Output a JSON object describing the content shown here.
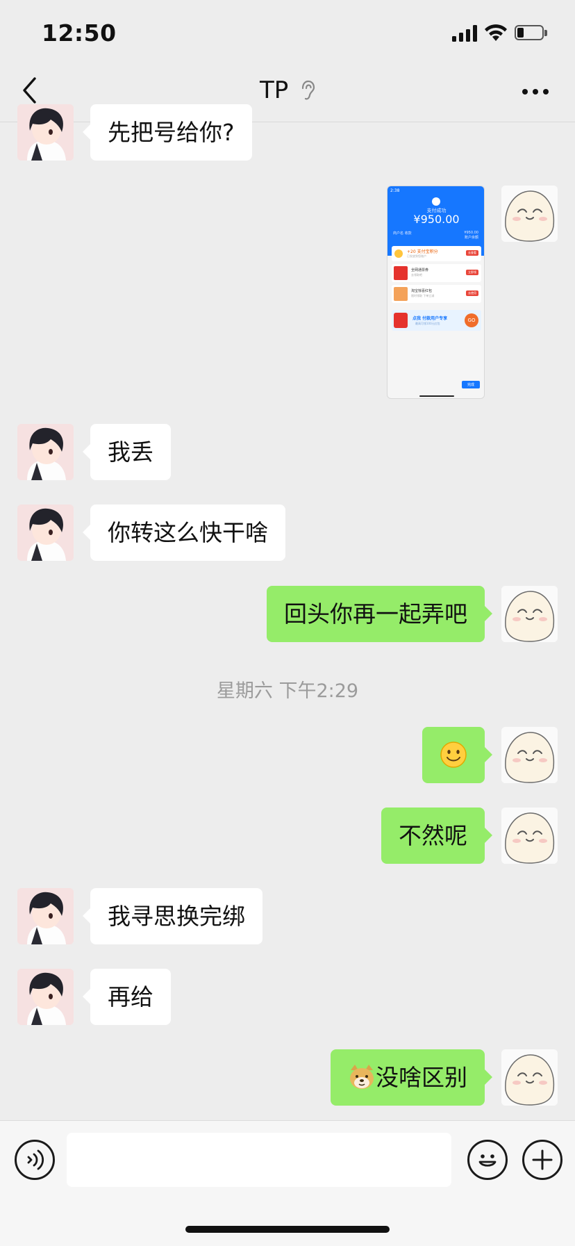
{
  "status_bar": {
    "time": "12:50",
    "battery_level": 0.25
  },
  "nav": {
    "title": "TP",
    "more_label": "···"
  },
  "messages": [
    {
      "from": "peer",
      "text": "先把号给你?"
    },
    {
      "from": "me",
      "type": "image",
      "image": {
        "status_time": "2:38",
        "header": "支付成功",
        "amount": "¥950.00",
        "left_label": "商户名 收款",
        "right_value": "¥950.00",
        "right_label": "账户余额",
        "rows": [
          {
            "title": "+20 支付宝积分",
            "sub": "已发放到您账户",
            "button": "去查看"
          },
          {
            "title": "全网通票券",
            "sub": "去领取吧",
            "button": "立即领"
          },
          {
            "title": "淘宝惊喜红包",
            "sub": "限时领取 下单立减",
            "button": "去使用"
          }
        ],
        "banner": "点我 付款用户专享",
        "banner_sub": "最高可领100元红包",
        "banner_button": "GO",
        "footer_button": "完成"
      }
    },
    {
      "from": "peer",
      "text": "我丢"
    },
    {
      "from": "peer",
      "text": "你转这么快干啥"
    },
    {
      "from": "me",
      "text": "回头你再一起弄吧"
    },
    {
      "type": "time",
      "text": "星期六 下午2:29"
    },
    {
      "from": "me",
      "type": "emoji",
      "emoji": "🙂"
    },
    {
      "from": "me",
      "text": "不然呢"
    },
    {
      "from": "peer",
      "text": "我寻思换完绑"
    },
    {
      "from": "peer",
      "text": "再给"
    },
    {
      "from": "me",
      "text": "没啥区别",
      "prefix_emoji": "doge-icon"
    }
  ],
  "input": {
    "value": "",
    "placeholder": ""
  },
  "colors": {
    "bg": "#ededed",
    "bubble_out": "#95ec69",
    "bubble_in": "#ffffff",
    "alipay_blue": "#1677ff"
  }
}
